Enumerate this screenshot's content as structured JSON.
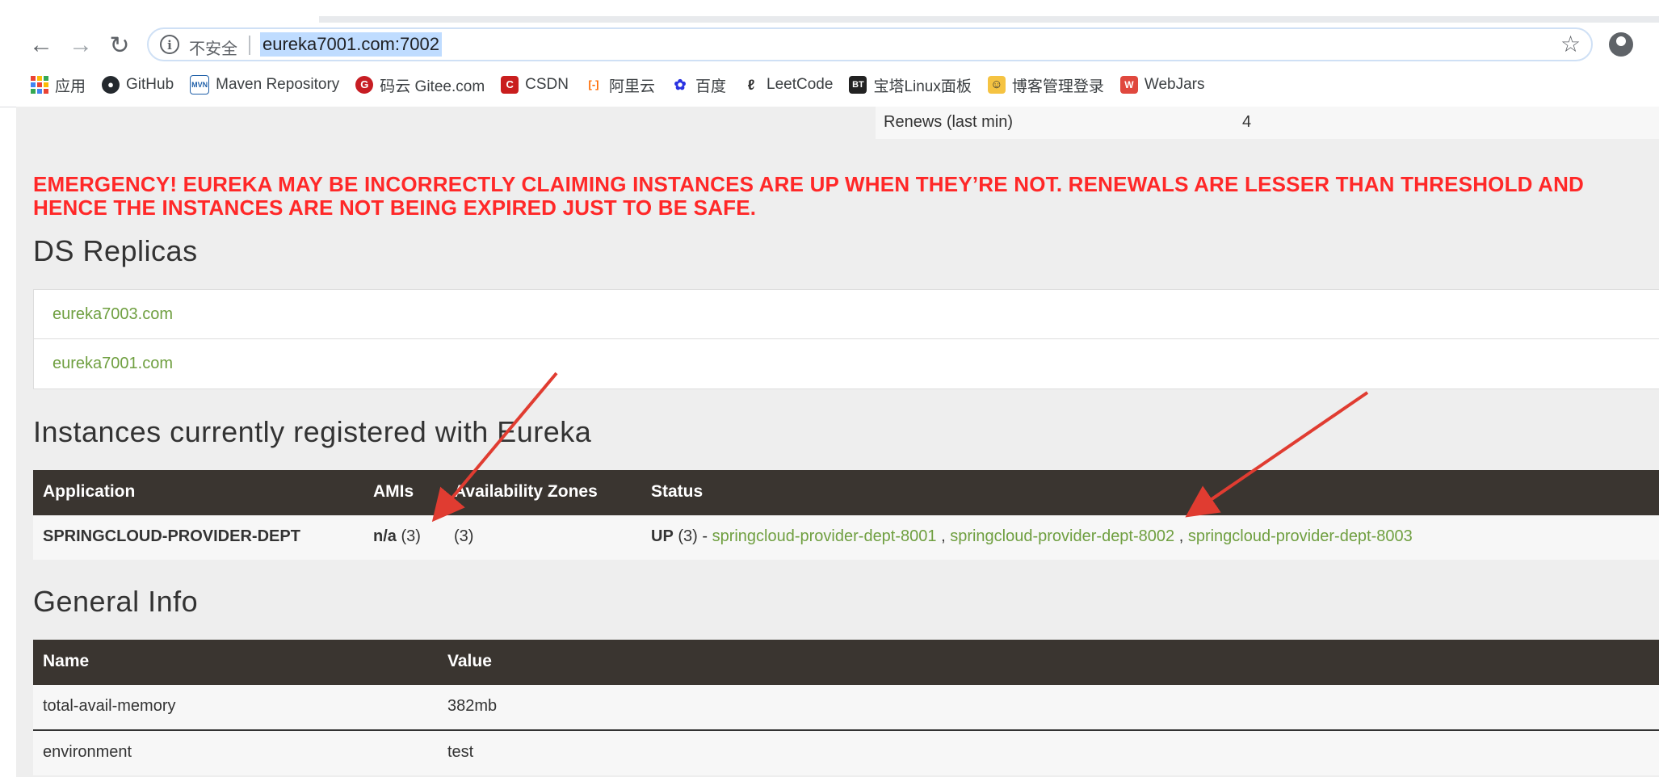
{
  "browser": {
    "security_label": "不安全",
    "url": "eureka7001.com:7002",
    "bookmarks": [
      {
        "label": "应用",
        "icon": "apps-grid-icon"
      },
      {
        "label": "GitHub",
        "icon": "github-icon"
      },
      {
        "label": "Maven Repository",
        "icon": "maven-icon",
        "badge": "MVN"
      },
      {
        "label": "码云 Gitee.com",
        "icon": "gitee-icon",
        "badge": "G"
      },
      {
        "label": "CSDN",
        "icon": "csdn-icon",
        "badge": "C"
      },
      {
        "label": "阿里云",
        "icon": "aliyun-icon",
        "badge": "[-]"
      },
      {
        "label": "百度",
        "icon": "baidu-paw-icon",
        "badge": "✿"
      },
      {
        "label": "LeetCode",
        "icon": "leetcode-icon",
        "badge": "ℓ"
      },
      {
        "label": "宝塔Linux面板",
        "icon": "bt-icon",
        "badge": "BT"
      },
      {
        "label": "博客管理登录",
        "icon": "blog-icon",
        "badge": "☺"
      },
      {
        "label": "WebJars",
        "icon": "webjars-icon",
        "badge": "W"
      }
    ]
  },
  "renews": {
    "label": "Renews (last min)",
    "value": "4"
  },
  "emergency_text": "EMERGENCY! EUREKA MAY BE INCORRECTLY CLAIMING INSTANCES ARE UP WHEN THEY’RE NOT. RENEWALS ARE LESSER THAN THRESHOLD AND HENCE THE INSTANCES ARE NOT BEING EXPIRED JUST TO BE SAFE.",
  "ds_replicas": {
    "heading": "DS Replicas",
    "items": [
      "eureka7003.com",
      "eureka7001.com"
    ]
  },
  "instances": {
    "heading": "Instances currently registered with Eureka",
    "columns": [
      "Application",
      "AMIs",
      "Availability Zones",
      "Status"
    ],
    "row": {
      "application": "SPRINGCLOUD-PROVIDER-DEPT",
      "ami_bold": "n/a",
      "ami_count": " (3)",
      "zones": "(3)",
      "status_bold": "UP",
      "status_count": " (3) - ",
      "links": [
        "springcloud-provider-dept-8001",
        "springcloud-provider-dept-8002",
        "springcloud-provider-dept-8003"
      ],
      "sep": " , "
    }
  },
  "general_info": {
    "heading": "General Info",
    "columns": [
      "Name",
      "Value"
    ],
    "rows": [
      {
        "name": "total-avail-memory",
        "value": "382mb"
      },
      {
        "name": "environment",
        "value": "test"
      }
    ]
  },
  "colors": {
    "emergency": "#ff2828",
    "link": "#6f9f40",
    "table_header": "#3a3530",
    "annotation_arrow": "#e03c31"
  }
}
